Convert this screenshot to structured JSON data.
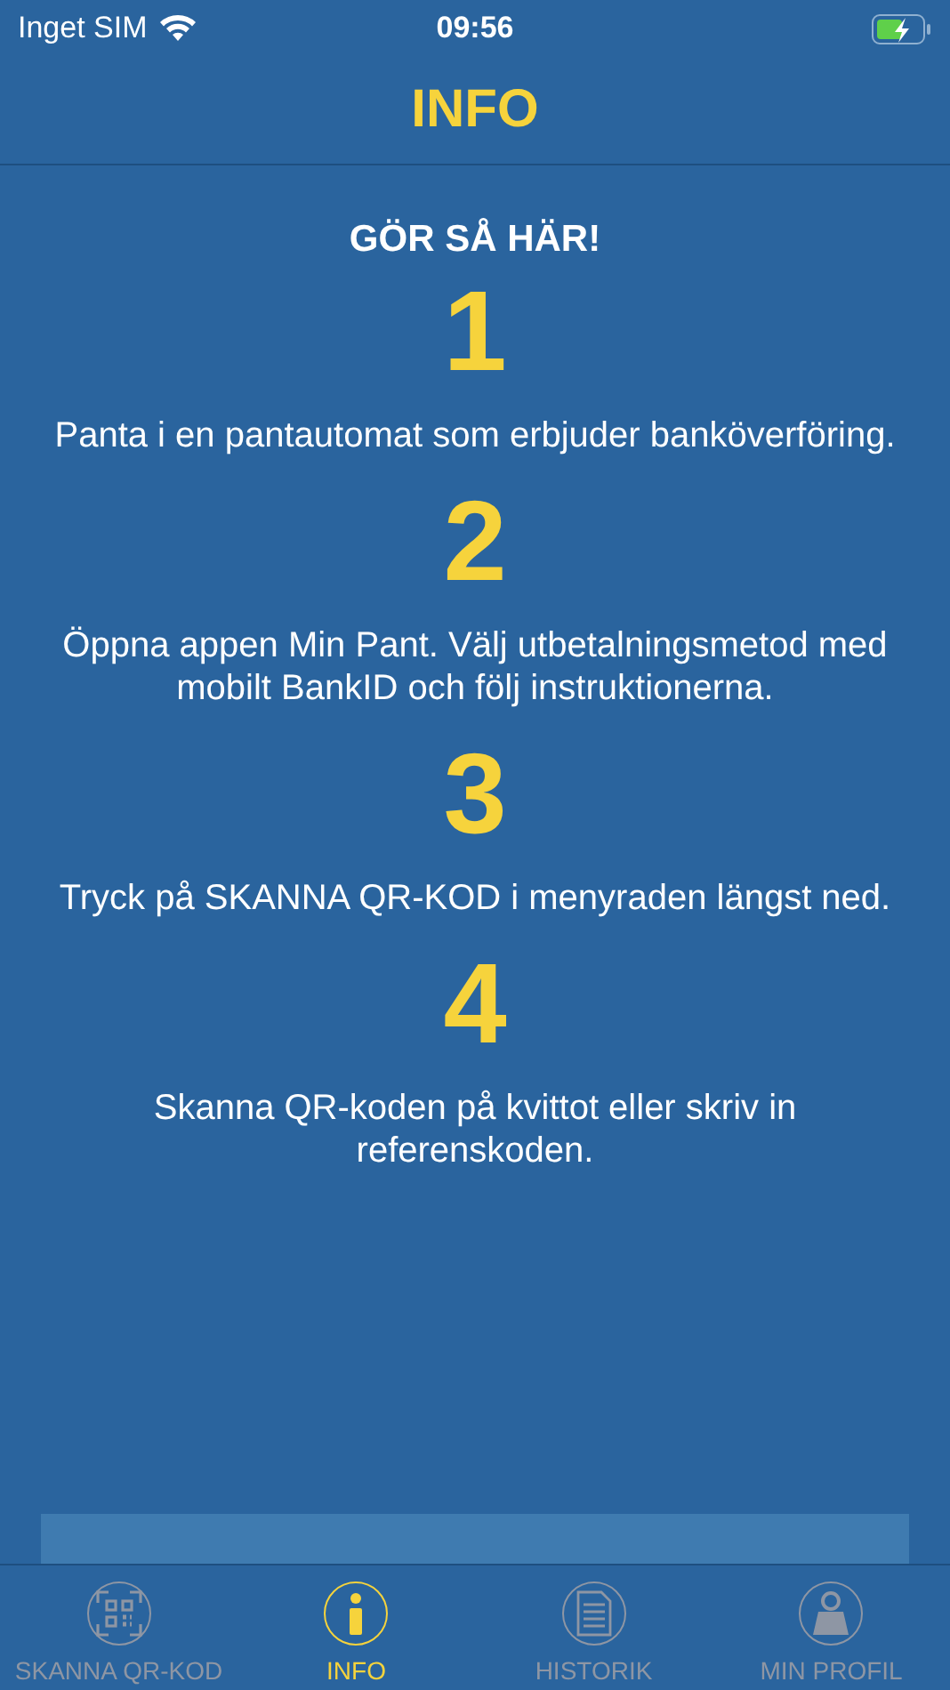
{
  "status_bar": {
    "carrier": "Inget SIM",
    "time": "09:56"
  },
  "header": {
    "title": "INFO"
  },
  "intro": {
    "title": "GÖR SÅ HÄR!"
  },
  "steps": [
    {
      "number": "1",
      "text": "Panta i en pantautomat som erbjuder banköverföring."
    },
    {
      "number": "2",
      "text": "Öppna appen Min Pant. Välj utbetalningsmetod med mobilt BankID och följ instruktionerna."
    },
    {
      "number": "3",
      "text": "Tryck på SKANNA QR-KOD i menyraden längst ned."
    },
    {
      "number": "4",
      "text": "Skanna QR-koden på kvittot eller skriv in referenskoden."
    }
  ],
  "tab_bar": [
    {
      "kind": "qr",
      "label": "SKANNA QR-KOD",
      "selected": false
    },
    {
      "kind": "info",
      "label": "INFO",
      "selected": true
    },
    {
      "kind": "history",
      "label": "HISTORIK",
      "selected": false
    },
    {
      "kind": "profile",
      "label": "MIN PROFIL",
      "selected": false
    }
  ]
}
